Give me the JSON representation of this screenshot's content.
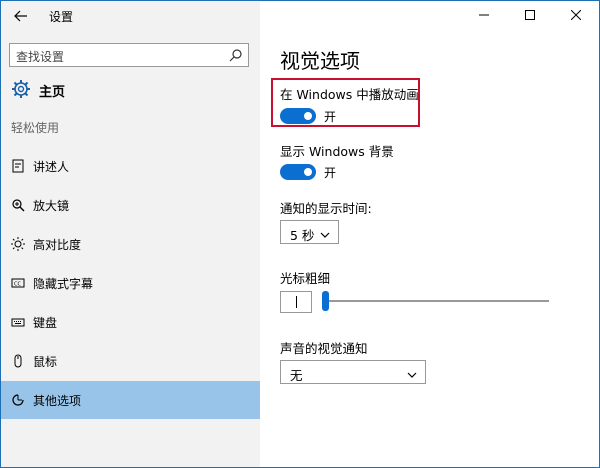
{
  "window": {
    "title": "设置"
  },
  "sidebar": {
    "search_placeholder": "查找设置",
    "home_label": "主页",
    "section_label": "轻松使用",
    "items": [
      {
        "label": "讲述人",
        "icon": "narrator-icon"
      },
      {
        "label": "放大镜",
        "icon": "magnifier-icon"
      },
      {
        "label": "高对比度",
        "icon": "brightness-icon"
      },
      {
        "label": "隐藏式字幕",
        "icon": "closed-caption-icon"
      },
      {
        "label": "键盘",
        "icon": "keyboard-icon"
      },
      {
        "label": "鼠标",
        "icon": "mouse-icon"
      },
      {
        "label": "其他选项",
        "icon": "other-options-icon",
        "active": true
      }
    ]
  },
  "main": {
    "title": "视觉选项",
    "animations": {
      "label": "在 Windows 中播放动画",
      "state": "开"
    },
    "background": {
      "label": "显示 Windows 背景",
      "state": "开"
    },
    "notification": {
      "label": "通知的显示时间:",
      "value": "5 秒"
    },
    "cursor": {
      "label": "光标粗细"
    },
    "audio_visual": {
      "label": "声音的视觉通知",
      "value": "无"
    }
  },
  "colors": {
    "accent": "#0a6fd1",
    "sidebar_active": "#99c4ea",
    "highlight_border": "#c8102e"
  }
}
